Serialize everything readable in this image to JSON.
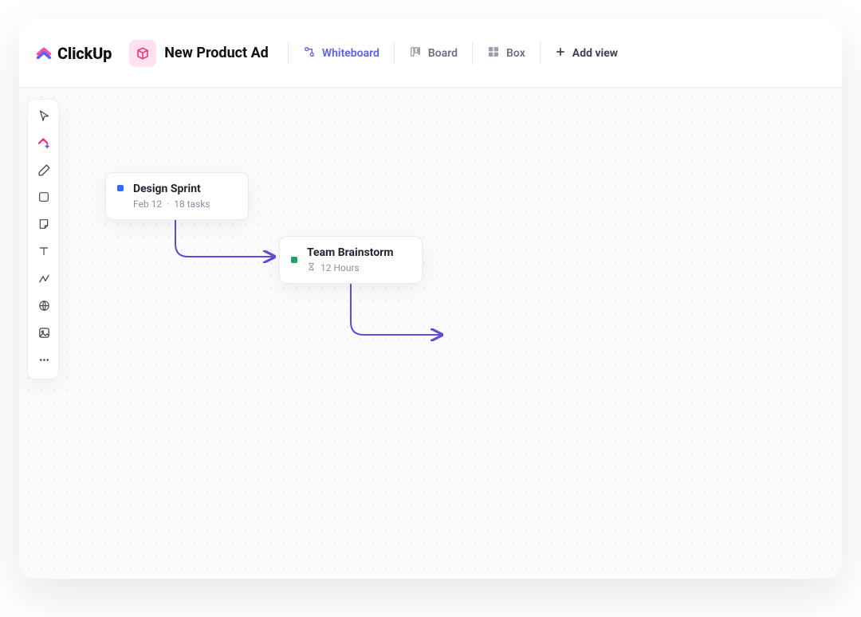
{
  "app": {
    "name": "ClickUp"
  },
  "breadcrumb": {
    "title": "New Product Ad"
  },
  "views": {
    "whiteboard": "Whiteboard",
    "board": "Board",
    "box": "Box",
    "addView": "Add view"
  },
  "cards": {
    "designSprint": {
      "title": "Design Sprint",
      "date": "Feb 12",
      "taskCount": "18 tasks",
      "markerColor": "#2f6bff"
    },
    "teamBrainstorm": {
      "title": "Team Brainstorm",
      "duration": "12 Hours",
      "markerColor": "#1fa463"
    }
  },
  "toolbox": {
    "cursor": "cursor-tool",
    "ai": "ai-tool",
    "pen": "pen-tool",
    "shape": "shape-tool",
    "sticky": "sticky-note-tool",
    "text": "text-tool",
    "connector": "connector-tool",
    "web": "web-tool",
    "image": "image-tool",
    "more": "more-tool"
  },
  "colors": {
    "accent": "#5d5fef",
    "pinkAccent": "#fb2576",
    "arrow": "#5b4dd6"
  }
}
